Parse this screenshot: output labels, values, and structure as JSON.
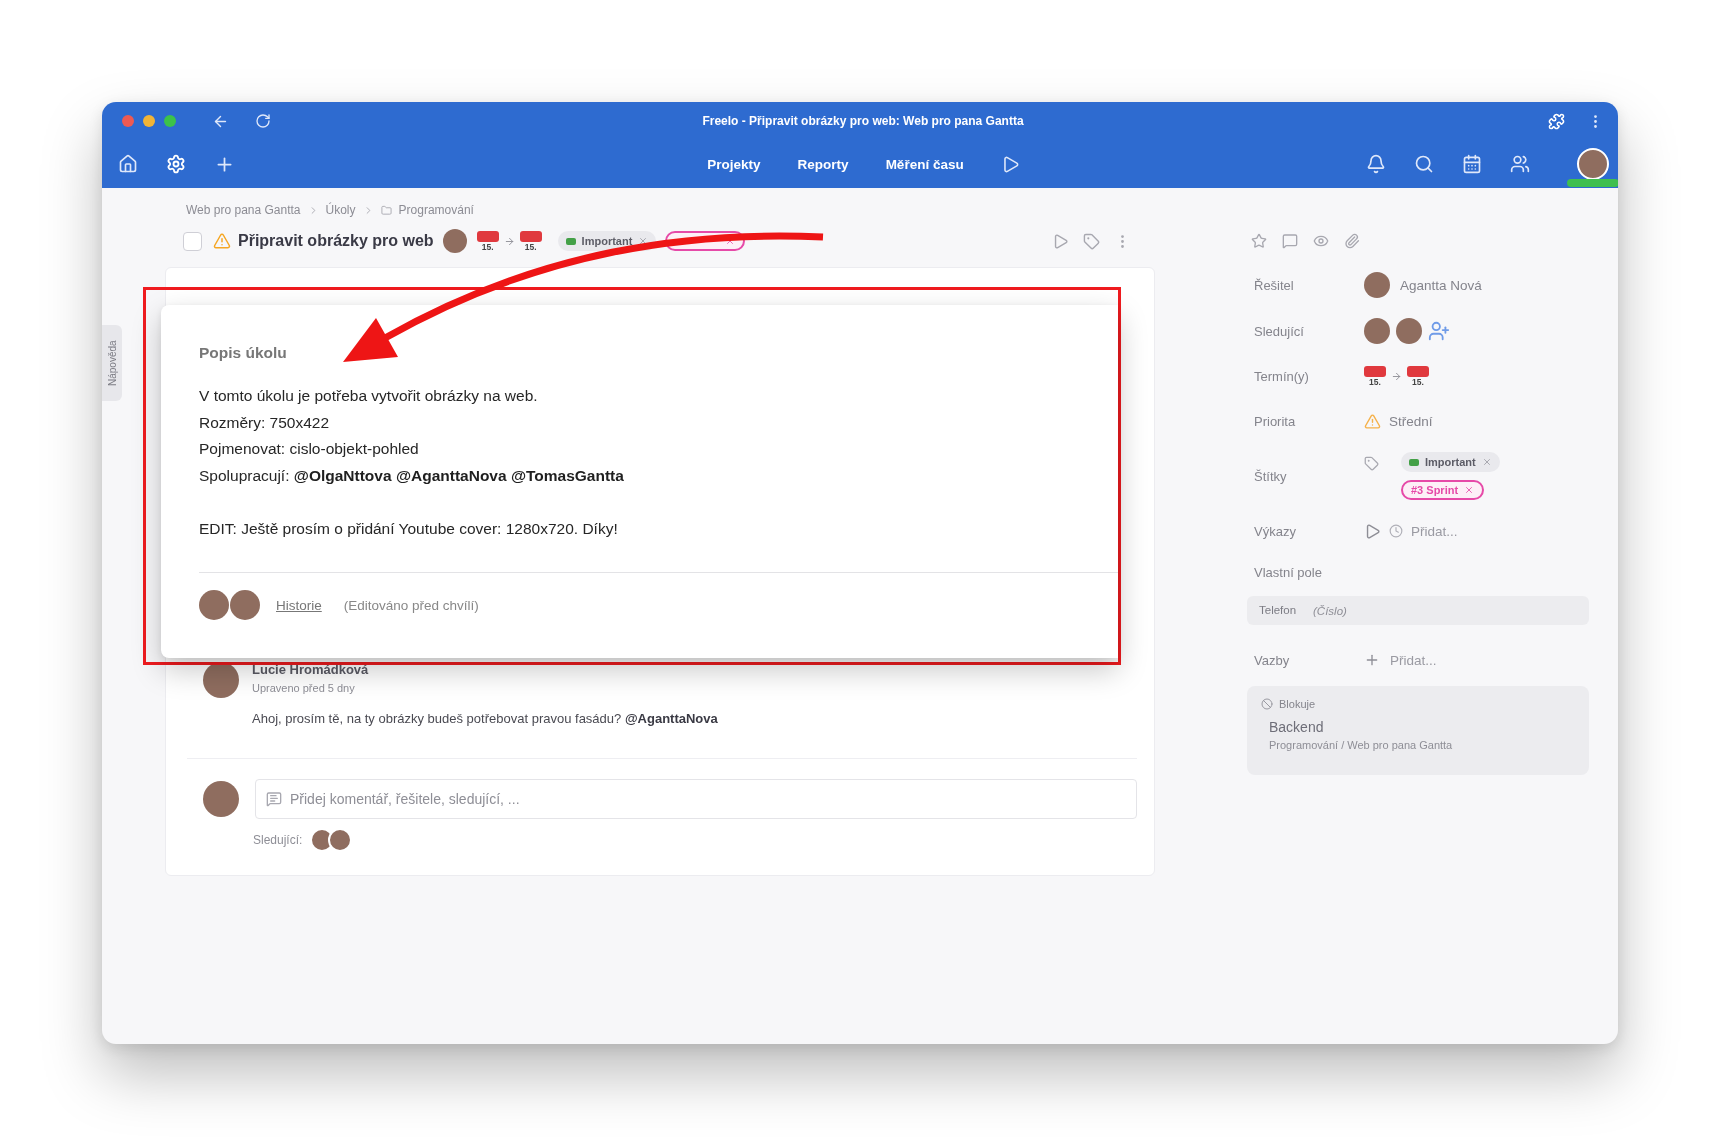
{
  "window": {
    "title": "Freelo - Připravit obrázky pro web: Web pro pana Gantta"
  },
  "nav": {
    "items": [
      {
        "label": "Projekty"
      },
      {
        "label": "Reporty"
      },
      {
        "label": "Měření času"
      }
    ]
  },
  "help_tab": {
    "label": "Nápověda"
  },
  "breadcrumb": [
    {
      "label": "Web pro pana Gantta",
      "kind": "link"
    },
    {
      "label": "Úkoly",
      "kind": "link"
    },
    {
      "label": "Programování",
      "kind": "folder"
    }
  ],
  "task": {
    "done": false,
    "title": "Připravit obrázky pro web",
    "dates": [
      {
        "day": "15."
      },
      {
        "day": "15."
      }
    ],
    "tags": [
      {
        "label": "Important",
        "kind": "swatch",
        "color": "#43a047"
      },
      {
        "kind": "outline",
        "color": "#e64aa8"
      }
    ]
  },
  "description": {
    "heading": "Popis úkolu",
    "paragraphs": [
      [
        "V tomto úkolu je potřeba vytvořit obrázky na web.",
        "Rozměry: 750x422",
        "Pojmenovat: cislo-objekt-pohled",
        "Spolupracují: **@OlgaNttova @AganttaNova @TomasGantta**"
      ],
      [
        "EDIT: Ještě prosím o přidání Youtube cover: 1280x720. Díky!"
      ]
    ],
    "history_link": "Historie",
    "edited": "(Editováno před chvílí)"
  },
  "comments": [
    {
      "author": "Lucie Hromádková",
      "time": "Upraveno před 5 dny",
      "text": "Ahoj, prosím tě, na ty obrázky budeš potřebovat pravou fasádu? **@AganttaNova**"
    }
  ],
  "comment_box": {
    "placeholder": "Přidej komentář, řešitele, sledující, ...",
    "followers_label": "Sledující:"
  },
  "sidebar": {
    "assignee": {
      "label": "Řešitel",
      "name": "Agantta Nová"
    },
    "followers": {
      "label": "Sledující"
    },
    "dates": {
      "label": "Termín(y)",
      "items": [
        {
          "day": "15."
        },
        {
          "day": "15."
        }
      ]
    },
    "priority": {
      "label": "Priorita",
      "value": "Střední"
    },
    "tags": {
      "label": "Štítky",
      "items": [
        {
          "label": "Important",
          "kind": "swatch",
          "color": "#43a047"
        },
        {
          "label": "#3 Sprint",
          "kind": "outline",
          "color": "#e64aa8"
        }
      ]
    },
    "reports": {
      "label": "Výkazy",
      "add": "Přidat..."
    },
    "custom_fields": {
      "label": "Vlastní pole",
      "fields": [
        {
          "label": "Telefon",
          "placeholder": "(Číslo)"
        }
      ]
    },
    "relations": {
      "label": "Vazby",
      "add": "Přidat...",
      "blocking": {
        "label": "Blokuje",
        "title": "Backend",
        "path": "Programování / Web pro pana Gantta"
      }
    }
  }
}
